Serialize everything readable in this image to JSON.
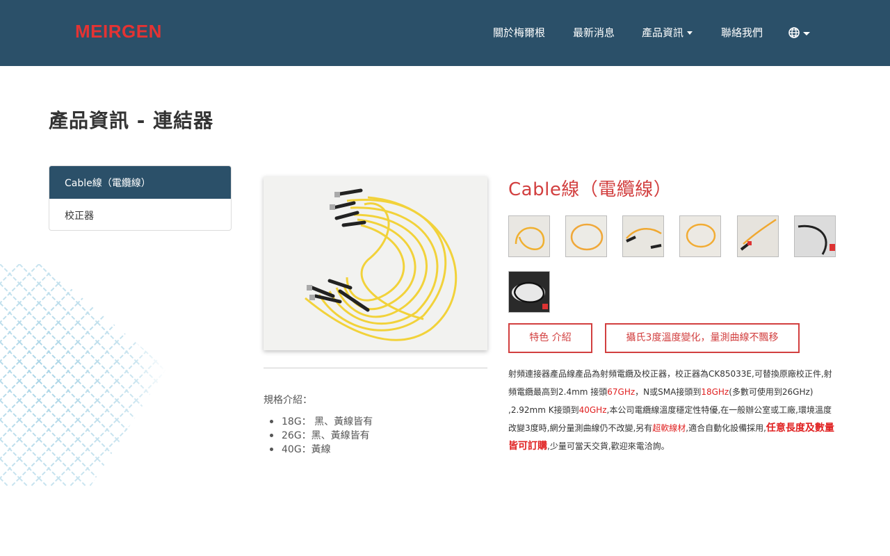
{
  "header": {
    "logo": "MEIRGEN",
    "nav": [
      {
        "label": "關於梅爾根"
      },
      {
        "label": "最新消息"
      },
      {
        "label": "產品資訊"
      },
      {
        "label": "聯絡我們"
      }
    ],
    "brand_color": "#2b5069",
    "logo_color": "#e53333"
  },
  "page_title": "產品資訊 - 連結器",
  "sidebar": {
    "items": [
      {
        "label": "Cable線（電纜線）",
        "active": true
      },
      {
        "label": "校正器",
        "active": false
      }
    ]
  },
  "product": {
    "title": "Cable線（電纜線）",
    "accent_color": "#d23f3f",
    "thumbnails_count": 7,
    "buttons": [
      "特色 介紹",
      "攝氏3度溫度變化，量測曲線不飄移"
    ],
    "spec_label": "規格介紹：",
    "specs": [
      "18G： 黑、黃線皆有",
      "26G：黑、黃線皆有",
      "40G：黃線"
    ],
    "description": {
      "p1": "射頻連接器產品線產品為射頻電纜及校正器，校正器為CK85033E,可替換原廠校正件,射頻電纜最高到2.4mm 接頭",
      "hl1": "67GHz",
      "p2": "，N或SMA接頭到",
      "hl2": "18GHz",
      "p3": "(多數可使用到26GHz) ,2.92mm K接頭到",
      "hl3": "40GHz",
      "p4": ",本公司電纜線溫度穩定性特優,在一般辦公室或工廠,環境溫度改變3度時,網分量測曲線仍不改變,另有",
      "hl4": "超軟線材",
      "p5": ",適合自動化設備採用,",
      "hl5": "任意長度及數量皆可訂購",
      "p6": ",少量可當天交貨,歡迎來電洽詢。"
    }
  }
}
